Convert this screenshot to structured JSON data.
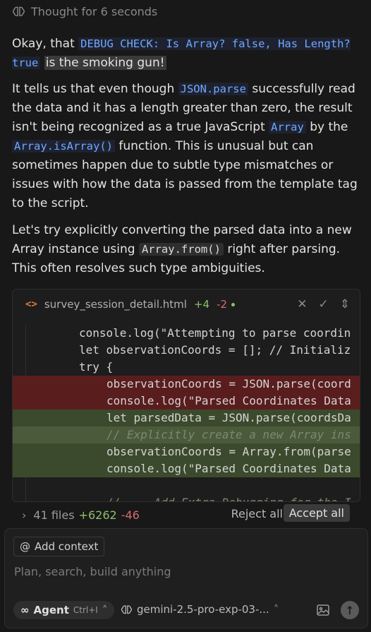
{
  "thought": {
    "label": "Thought for 6 seconds",
    "icon": "brain-icon"
  },
  "message": {
    "p1_a": "Okay, that ",
    "p1_code": "DEBUG CHECK: Is Array? false, Has Length? true",
    "p1_b": "is the smoking gun!",
    "p2_a": "It tells us that even though ",
    "p2_code1": "JSON.parse",
    "p2_b": " successfully read the data and it has a length greater than zero, the result isn't being recognized as a true JavaScript ",
    "p2_code2": "Array",
    "p2_c": " by the ",
    "p2_code3": "Array.isArray()",
    "p2_d": " function. This is unusual but can sometimes happen due to subtle type mismatches or issues with how the data is passed from the template tag to the script.",
    "p3_a": "Let's try explicitly converting the parsed data into a new Array instance using ",
    "p3_code": "Array.from()",
    "p3_b": " right after parsing. This often resolves such type ambiguities."
  },
  "diff_card": {
    "filename": "survey_session_detail.html",
    "added": "+4",
    "removed": "-2",
    "file_icon": "<>",
    "lines": [
      {
        "text": "console.log(\"Attempting to parse coordin",
        "kind": "ctx",
        "indent": 1
      },
      {
        "text": "let observationCoords = []; // Initializ",
        "kind": "ctx",
        "indent": 1
      },
      {
        "text": "try {",
        "kind": "ctx",
        "indent": 1
      },
      {
        "text": "observationCoords = JSON.parse(coord",
        "kind": "rm",
        "indent": 2
      },
      {
        "text": "console.log(\"Parsed Coordinates Data",
        "kind": "rm",
        "indent": 2
      },
      {
        "text": "let parsedData = JSON.parse(coordsDa",
        "kind": "ad",
        "indent": 2
      },
      {
        "text": "// Explicitly create a new Array ins",
        "kind": "ad2",
        "indent": 2
      },
      {
        "text": "observationCoords = Array.from(parse",
        "kind": "ad",
        "indent": 2
      },
      {
        "text": "console.log(\"Parsed Coordinates Data",
        "kind": "ad",
        "indent": 2
      },
      {
        "text": "",
        "kind": "ctx",
        "indent": 2
      },
      {
        "text": "// --- Add Extra Debugging for the I",
        "kind": "ctx",
        "indent": 2
      }
    ]
  },
  "files_bar": {
    "summary": "41 files",
    "added": "+6262",
    "removed": "-46",
    "reject_label": "Reject all",
    "accept_label": "Accept all"
  },
  "composer": {
    "add_context_label": "Add context",
    "placeholder": "Plan, search, build anything",
    "agent_label": "Agent",
    "agent_shortcut": "Ctrl+I",
    "model_label": "gemini-2.5-pro-exp-03-..."
  }
}
